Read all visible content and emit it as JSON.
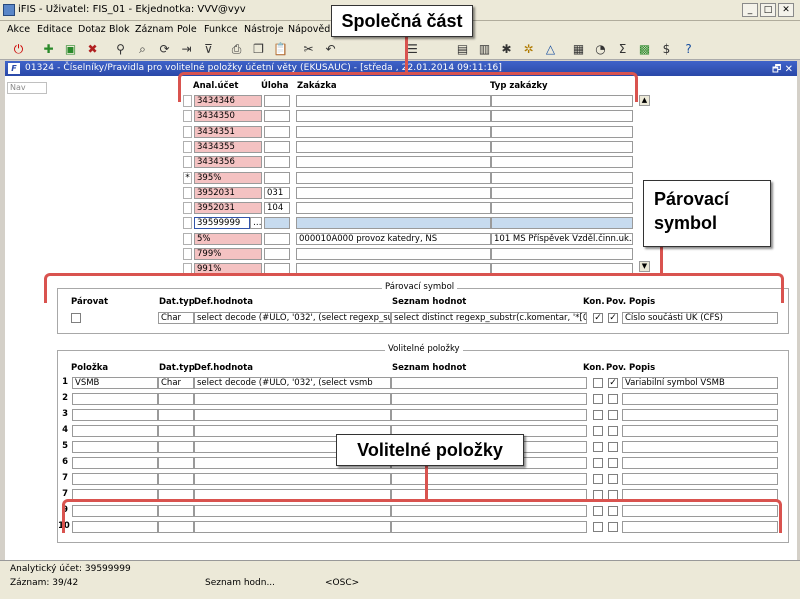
{
  "window": {
    "title": "iFIS - Uživatel: FIS_01 - Ekjednotka: VVV@vyv",
    "buttons": [
      "_",
      "□",
      "✕"
    ]
  },
  "menu": [
    "Akce",
    "Editace",
    "Dotaz",
    "Blok",
    "Záznam",
    "Pole",
    "Funkce",
    "Nástroje",
    "Nápověd"
  ],
  "toolbar_icons": [
    "exit-icon",
    "new-icon",
    "save-icon",
    "delete-icon",
    "search-icon",
    "filter-icon",
    "print-icon",
    "copy-icon",
    "cut-icon",
    "paste-icon",
    "list-icon",
    "doc-icon",
    "calc-icon",
    "sum-icon",
    "help-icon"
  ],
  "form": {
    "title": "01324 - Číselníky/Pravidla pro volitelné položky účetní věty (EKUSAUC) - [středa , 22.01.2014 09:11:16]",
    "nav": "Nav",
    "controls": "🗗 ✕"
  },
  "master": {
    "headers": {
      "account": "Anal.účet",
      "task": "Úloha",
      "contract": "Zakázka",
      "contract_type": "Typ zakázky"
    },
    "rows": [
      {
        "ind": "",
        "account": "3434346",
        "task": "",
        "contract": "",
        "type": ""
      },
      {
        "ind": "",
        "account": "3434350",
        "task": "",
        "contract": "",
        "type": ""
      },
      {
        "ind": "",
        "account": "3434351",
        "task": "",
        "contract": "",
        "type": ""
      },
      {
        "ind": "",
        "account": "3434355",
        "task": "",
        "contract": "",
        "type": ""
      },
      {
        "ind": "",
        "account": "3434356",
        "task": "",
        "contract": "",
        "type": ""
      },
      {
        "ind": "*",
        "account": "395%",
        "task": "",
        "contract": "",
        "type": ""
      },
      {
        "ind": "",
        "account": "3952031",
        "task": "031",
        "contract": "",
        "type": ""
      },
      {
        "ind": "",
        "account": "3952031",
        "task": "104",
        "contract": "",
        "type": ""
      },
      {
        "ind": "",
        "account": "39599999",
        "task": "",
        "contract": "",
        "type": ""
      },
      {
        "ind": "",
        "account": "5%",
        "task": "",
        "contract": "000010A000 provoz katedry, NS",
        "type": "101 MŠ Příspěvek Vzděl.činn.uk.A,B"
      },
      {
        "ind": "",
        "account": "799%",
        "task": "",
        "contract": "",
        "type": ""
      },
      {
        "ind": "",
        "account": "991%",
        "task": "",
        "contract": "",
        "type": ""
      }
    ]
  },
  "pairing": {
    "legend": "Párovací symbol",
    "headers": {
      "pair": "Párovat",
      "dtype": "Dat.typ",
      "default": "Def.hodnota",
      "values": "Seznam hodnot",
      "kon": "Kon.",
      "pov": "Pov.",
      "desc": "Popis"
    },
    "row": {
      "dtype": "Char",
      "default": "select decode (#ULO, '032', (select regexp_substr(",
      "values": "select distinct regexp_substr(c.komentar, '*[0-9]{1,",
      "kon": "✓",
      "pov": "✓",
      "desc": "Číslo součásti UK (ČFS)"
    }
  },
  "optional": {
    "legend": "Volitelné položky",
    "headers": {
      "item": "Položka",
      "dtype": "Dat.typ",
      "default": "Def.hodnota",
      "values": "Seznam hodnot",
      "kon": "Kon.",
      "pov": "Pov.",
      "desc": "Popis"
    },
    "rows": [
      {
        "n": "1",
        "item": "VSMB",
        "dtype": "Char",
        "default": "select decode (#ULO, '032', (select vsmb",
        "values": "",
        "kon": "",
        "pov": "✓",
        "desc": "Variabilní symbol VSMB"
      },
      {
        "n": "2",
        "item": "",
        "dtype": "",
        "default": "",
        "values": "",
        "kon": "",
        "pov": "",
        "desc": ""
      },
      {
        "n": "3",
        "item": "",
        "dtype": "",
        "default": "",
        "values": "",
        "kon": "",
        "pov": "",
        "desc": ""
      },
      {
        "n": "4",
        "item": "",
        "dtype": "",
        "default": "",
        "values": "",
        "kon": "",
        "pov": "",
        "desc": ""
      },
      {
        "n": "5",
        "item": "",
        "dtype": "",
        "default": "",
        "values": "",
        "kon": "",
        "pov": "",
        "desc": ""
      },
      {
        "n": "6",
        "item": "",
        "dtype": "",
        "default": "",
        "values": "",
        "kon": "",
        "pov": "",
        "desc": ""
      },
      {
        "n": "7",
        "item": "",
        "dtype": "",
        "default": "",
        "values": "",
        "kon": "",
        "pov": "",
        "desc": ""
      },
      {
        "n": "7",
        "item": "",
        "dtype": "",
        "default": "",
        "values": "",
        "kon": "",
        "pov": "",
        "desc": ""
      },
      {
        "n": "9",
        "item": "",
        "dtype": "",
        "default": "",
        "values": "",
        "kon": "",
        "pov": "",
        "desc": ""
      },
      {
        "n": "10",
        "item": "",
        "dtype": "",
        "default": "",
        "values": "",
        "kon": "",
        "pov": "",
        "desc": ""
      }
    ]
  },
  "status": {
    "line1": "Analytický účet: 39599999",
    "record": "Záznam: 39/42",
    "list": "Seznam hodn...",
    "osc": "<OSC>"
  },
  "callouts": {
    "common": "Společná část",
    "pairing": "Párovací symbol",
    "optional": "Volitelné položky"
  },
  "colors": {
    "accent": "#d9534f",
    "title": "#2a48a8",
    "required": "#f4c2c2"
  }
}
